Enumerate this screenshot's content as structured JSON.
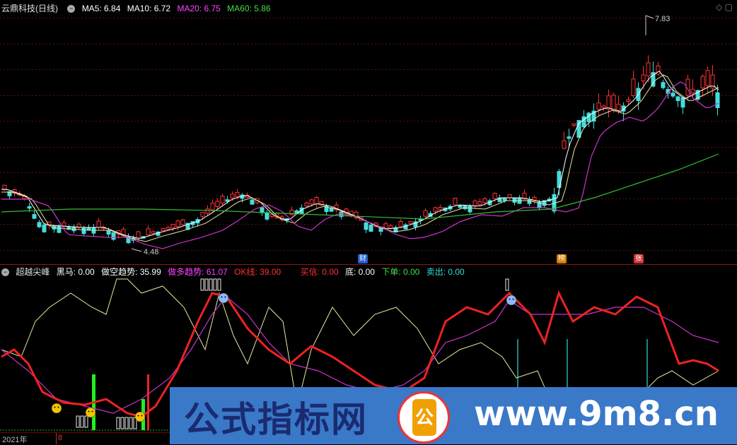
{
  "header": {
    "stock_name": "云鼎科技(日线)",
    "collapse_icon": "minus-circle-icon",
    "ma": [
      {
        "label": "MA5: 6.84",
        "color": "#ffffff"
      },
      {
        "label": "MA10: 6.72",
        "color": "#ffffff"
      },
      {
        "label": "MA20: 6.75",
        "color": "#ff44ff"
      },
      {
        "label": "MA60: 5.86",
        "color": "#44dd44"
      }
    ],
    "icons": [
      "diamond-icon",
      "square-icon"
    ]
  },
  "main_chart": {
    "high_label": "7.83",
    "low_label": "4.48",
    "high_value": 7.83,
    "low_value": 4.48,
    "tags": [
      {
        "text": "财",
        "color": "#1e5fd0"
      },
      {
        "text": "榜",
        "color": "#d07a00"
      },
      {
        "text": "张",
        "color": "#d03030"
      }
    ]
  },
  "indicator": {
    "name": "超越尖峰",
    "values": [
      {
        "label": "黑马: 0.00",
        "color": "#ffffff"
      },
      {
        "label": "做空趋势: 35.99",
        "color": "#ffffff"
      },
      {
        "label": "做多趋势: 61.07",
        "color": "#ff44ff"
      },
      {
        "label": "OK线: 39.00",
        "color": "#ff3333"
      },
      {
        "label": "买信: 0.00",
        "color": "#ff3333"
      },
      {
        "label": "底: 0.00",
        "color": "#ffffff"
      },
      {
        "label": "下单: 0.00",
        "color": "#44dd44"
      },
      {
        "label": "卖出: 0.00",
        "color": "#33dddd"
      }
    ]
  },
  "footer": {
    "year": "2021年",
    "month": "8"
  },
  "watermark": {
    "left_text": "公式指标网",
    "logo_text": "公",
    "right_text": "www.9m8.cn"
  }
}
